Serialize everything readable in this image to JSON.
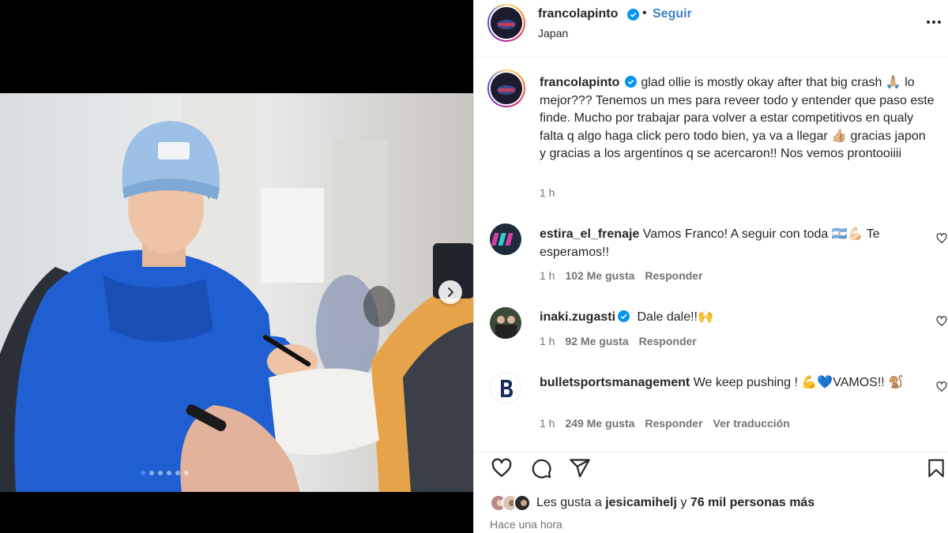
{
  "post": {
    "username": "francolapinto",
    "location": "Japan",
    "follow_label": "Seguir",
    "bullet": "•",
    "caption": "glad ollie is mostly okay after that big crash 🙏🏼 lo mejor??? Tenemos un mes para reveer todo y entender que paso este finde. Mucho por trabajar para volver a estar competitivos en qualy falta q algo haga click pero todo bien, ya va a llegar 👍🏼 gracias japon y gracias a los argentinos q se acercaron!! Nos vemos prontooiiii",
    "caption_time": "1 h",
    "carousel": {
      "total": 6,
      "active_index": 0
    }
  },
  "comments": [
    {
      "username": "estira_el_frenaje",
      "verified": false,
      "text": "Vamos Franco! A seguir con toda 🇦🇷💪🏻 Te esperamos!!",
      "time": "1 h",
      "likes": "102 Me gusta",
      "reply": "Responder",
      "translate": ""
    },
    {
      "username": "inaki.zugasti",
      "verified": true,
      "text": "Dale dale!!🙌",
      "time": "1 h",
      "likes": "92 Me gusta",
      "reply": "Responder",
      "translate": ""
    },
    {
      "username": "bulletsportsmanagement",
      "verified": false,
      "text": "We keep pushing ! 💪💙VAMOS!! 🐒",
      "time": "1 h",
      "likes": "249 Me gusta",
      "reply": "Responder",
      "translate": "Ver traducción"
    }
  ],
  "likes_summary": {
    "prefix": "Les gusta a",
    "user": "jesicamihelj",
    "connector": "y",
    "others": "76 mil personas más"
  },
  "posted_ago": "Hace una hora",
  "colors": {
    "follow": "#3b82c4",
    "verified": "#0095f6",
    "muted": "#737373",
    "text": "#262626",
    "carousel_active_dot": "#3e8ef7"
  },
  "icons": [
    "more-options-icon",
    "verified-icon",
    "heart-icon",
    "comment-icon",
    "share-icon",
    "bookmark-icon",
    "chevron-right-icon"
  ]
}
